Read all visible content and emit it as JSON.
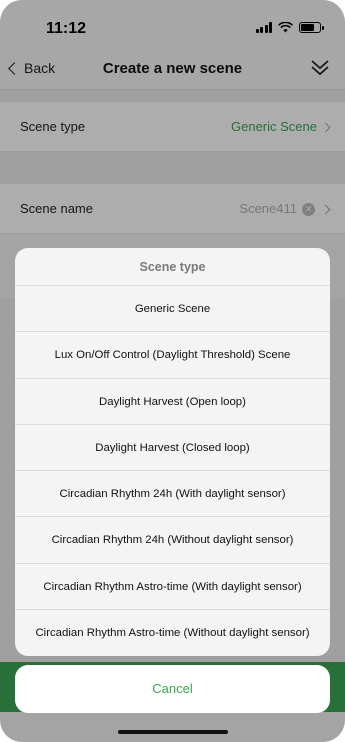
{
  "status_bar": {
    "time": "11:12",
    "signal_icon": "cellular-signal-icon",
    "wifi_icon": "wifi-icon",
    "battery_icon": "battery-icon"
  },
  "nav": {
    "back_label": "Back",
    "title": "Create a new scene",
    "right_icon": "double-chevron-down-icon"
  },
  "rows": {
    "scene_type_label": "Scene type",
    "scene_type_value": "Generic Scene",
    "scene_name_label": "Scene name",
    "scene_name_value": "Scene411"
  },
  "sheet": {
    "title": "Scene type",
    "options": [
      "Generic Scene",
      "Lux On/Off Control (Daylight Threshold) Scene",
      "Daylight Harvest (Open loop)",
      "Daylight Harvest (Closed loop)",
      "Circadian Rhythm 24h (With daylight sensor)",
      "Circadian Rhythm 24h (Without daylight sensor)",
      "Circadian Rhythm Astro-time (With daylight sensor)",
      "Circadian Rhythm Astro-time (Without daylight sensor)"
    ],
    "cancel_label": "Cancel"
  },
  "colors": {
    "accent": "#3aa655"
  }
}
